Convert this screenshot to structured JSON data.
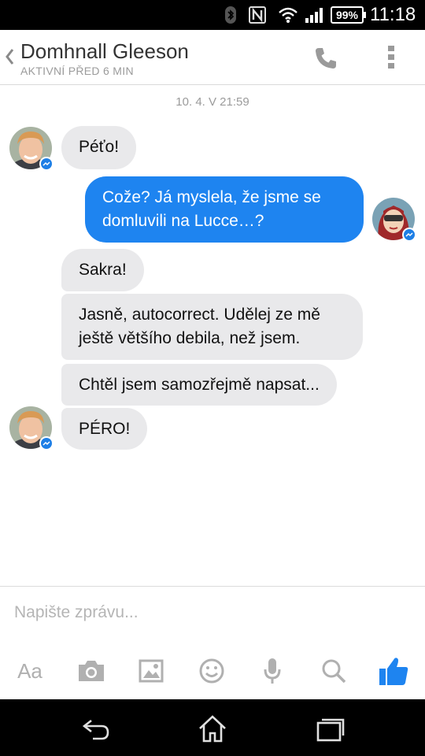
{
  "status_bar": {
    "battery": "99%",
    "time": "11:18",
    "icons": [
      "bluetooth-icon",
      "nfc-icon",
      "wifi-icon",
      "signal-icon",
      "battery-icon"
    ]
  },
  "header": {
    "name": "Domhnall Gleeson",
    "status": "AKTIVNÍ PŘED 6 MIN"
  },
  "chat": {
    "timestamp": "10. 4. V 21:59",
    "messages": [
      {
        "from": "contact",
        "text": "Péťo!"
      },
      {
        "from": "me",
        "text": "Cože? Já myslela, že jsme se domluvili na Lucce…?"
      },
      {
        "from": "contact",
        "text": "Sakra!"
      },
      {
        "from": "contact",
        "text": "Jasně, autocorrect. Udělej ze mě ještě většího debila, než jsem."
      },
      {
        "from": "contact",
        "text": "Chtěl jsem samozřejmě napsat..."
      },
      {
        "from": "contact",
        "text": "PÉRO!"
      }
    ]
  },
  "composer": {
    "placeholder": "Napište zprávu..."
  },
  "toolbar": {
    "text_label": "Aa",
    "icons": [
      "text-format-icon",
      "camera-icon",
      "image-icon",
      "emoji-icon",
      "microphone-icon",
      "search-icon",
      "thumbs-up-icon"
    ]
  },
  "navbar": {
    "icons": [
      "back-icon",
      "home-icon",
      "recents-icon"
    ]
  },
  "colors": {
    "accent": "#1e84f0",
    "incoming_bubble": "#e9e9eb",
    "muted_text": "#9b9b9b"
  }
}
